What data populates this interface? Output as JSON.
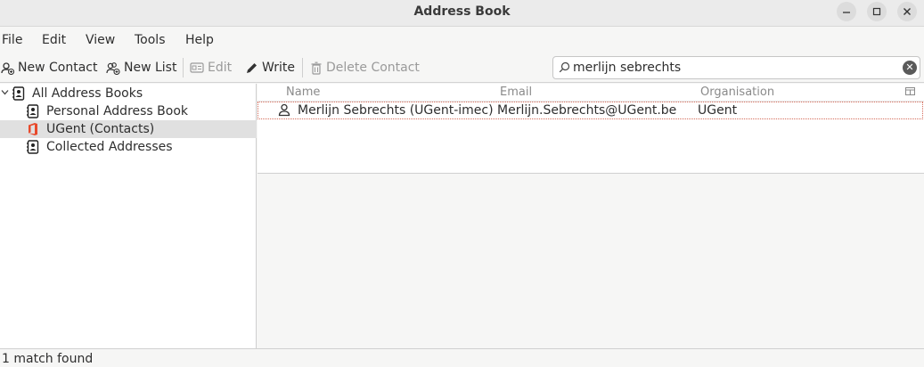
{
  "window": {
    "title": "Address Book"
  },
  "menubar": {
    "file": "File",
    "edit": "Edit",
    "view": "View",
    "tools": "Tools",
    "help": "Help"
  },
  "toolbar": {
    "new_contact": "New Contact",
    "new_list": "New List",
    "edit": "Edit",
    "write": "Write",
    "delete_contact": "Delete Contact"
  },
  "search": {
    "value": "merlijn sebrechts"
  },
  "sidebar": {
    "items": [
      {
        "label": "All Address Books",
        "icon": "address-book-icon",
        "expanded": true
      },
      {
        "label": "Personal Address Book",
        "icon": "address-book-icon"
      },
      {
        "label": "UGent (Contacts)",
        "icon": "office-icon",
        "selected": true
      },
      {
        "label": "Collected Addresses",
        "icon": "address-book-icon"
      }
    ]
  },
  "table": {
    "columns": {
      "name": "Name",
      "email": "Email",
      "organisation": "Organisation"
    },
    "rows": [
      {
        "name": "Merlijn Sebrechts (UGent-imec)",
        "email": "Merlijn.Sebrechts@UGent.be",
        "organisation": "UGent"
      }
    ]
  },
  "status": {
    "text": "1 match found"
  },
  "colors": {
    "office_accent": "#e8492b",
    "selection": "#e0e0e0"
  }
}
